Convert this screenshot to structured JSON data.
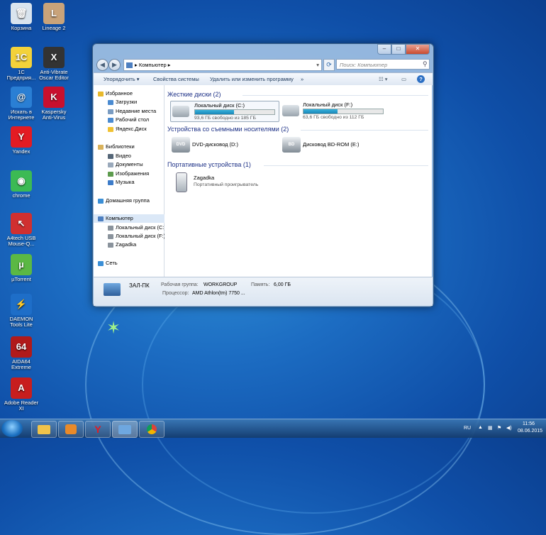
{
  "desktop": {
    "icons": [
      {
        "label": "Корзина",
        "icon": "recycle-bin-icon",
        "color": "#d9e4ee"
      },
      {
        "label": "Lineage 2",
        "icon": "game-icon",
        "color": "#c9a37a"
      },
      {
        "label": "1С Предприя...",
        "icon": "1c-icon",
        "color": "#f3d23a"
      },
      {
        "label": "Anti-Vibrate Oscar Editor",
        "icon": "oscar-icon",
        "color": "#333333"
      },
      {
        "label": "Искать в Интернете",
        "icon": "search-web-icon",
        "color": "#2a7fd4"
      },
      {
        "label": "Kaspersky Anti-Virus",
        "icon": "kaspersky-icon",
        "color": "#c8102e"
      },
      {
        "label": "Yandex",
        "icon": "yandex-icon",
        "color": "#e31b23"
      },
      {
        "label": "chrome",
        "icon": "chrome-icon",
        "color": "#3cba54"
      },
      {
        "label": "A4tech USB Mouse-Q...",
        "icon": "mouse-icon",
        "color": "#d03030"
      },
      {
        "label": "µTorrent",
        "icon": "utorrent-icon",
        "color": "#5bb844"
      },
      {
        "label": "DAEMON Tools Lite",
        "icon": "daemon-tools-icon",
        "color": "#1e6ec8"
      },
      {
        "label": "AIDA64 Extreme",
        "icon": "aida64-icon",
        "color": "#b01a1a"
      },
      {
        "label": "Adobe Reader XI",
        "icon": "adobe-reader-icon",
        "color": "#c81e1e"
      }
    ],
    "glyphs": [
      "🗑",
      "L",
      "1С",
      "X",
      "@",
      "K",
      "Y",
      "◉",
      "↖",
      "µ",
      "⚡",
      "64",
      "A"
    ]
  },
  "window": {
    "address": "Компьютер",
    "search_placeholder": "Поиск: Компьютер",
    "caption": {
      "min": "–",
      "max": "□",
      "close": "✕"
    },
    "toolbar": {
      "organize": "Упорядочить ▾",
      "properties": "Свойства системы",
      "uninstall": "Удалить или изменить программу",
      "more": "»"
    },
    "nav": [
      {
        "label": "Избранное",
        "icon": "star-icon",
        "color": "#e8b92c"
      },
      {
        "label": "Загрузки",
        "icon": "downloads-icon",
        "color": "#4b8bd1"
      },
      {
        "label": "Недавние места",
        "icon": "recent-places-icon",
        "color": "#7a9cc2"
      },
      {
        "label": "Рабочий стол",
        "icon": "desktop-icon",
        "color": "#4b8bd1"
      },
      {
        "label": "Яндекс.Диск",
        "icon": "yandex-disk-icon",
        "color": "#f1c232"
      },
      {
        "label": "Библиотеки",
        "icon": "libraries-icon",
        "color": "#d9b25b"
      },
      {
        "label": "Видео",
        "icon": "video-icon",
        "color": "#556677"
      },
      {
        "label": "Документы",
        "icon": "documents-icon",
        "color": "#9aa9bb"
      },
      {
        "label": "Изображения",
        "icon": "pictures-icon",
        "color": "#5d9b4e"
      },
      {
        "label": "Музыка",
        "icon": "music-icon",
        "color": "#3d7cc9"
      },
      {
        "label": "Домашняя группа",
        "icon": "homegroup-icon",
        "color": "#3b8fd6"
      },
      {
        "label": "Компьютер",
        "icon": "computer-icon",
        "color": "#4d7fc0"
      },
      {
        "label": "Локальный диск (C:)",
        "icon": "disk-icon",
        "color": "#8a939c"
      },
      {
        "label": "Локальный диск (F:)",
        "icon": "disk-icon",
        "color": "#8a939c"
      },
      {
        "label": "Zagadka",
        "icon": "player-icon",
        "color": "#8a939c"
      },
      {
        "label": "Сеть",
        "icon": "network-icon",
        "color": "#3b8fd6"
      }
    ],
    "groups": {
      "hdd": "Жесткие диски (2)",
      "removable": "Устройства со съемными носителями (2)",
      "portable": "Портативные устройства (1)"
    },
    "drives": [
      {
        "name": "Локальный диск (C:)",
        "free": "93,6 ГБ свободно из 185 ГБ",
        "used_fraction": 0.49
      },
      {
        "name": "Локальный диск (F:)",
        "free": "63,6 ГБ свободно из 112 ГБ",
        "used_fraction": 0.43
      }
    ],
    "removable": [
      {
        "name": "DVD-дисковод (D:)",
        "badge": "DVD"
      },
      {
        "name": "Дисковод BD-ROM (E:)",
        "badge": "BD"
      }
    ],
    "portable": {
      "name": "Zagadka",
      "sub": "Портативный проигрыватель"
    },
    "status": {
      "pc": "ЗАЛ-ПК",
      "workgroup_label": "Рабочая группа:",
      "workgroup": "WORKGROUP",
      "memory_label": "Память:",
      "memory": "6,00 ГБ",
      "cpu_label": "Процессор:",
      "cpu": "AMD Athlon(tm) 7750 ..."
    }
  },
  "taskbar": {
    "lang": "RU",
    "time": "11:56",
    "date": "08.06.2015"
  }
}
